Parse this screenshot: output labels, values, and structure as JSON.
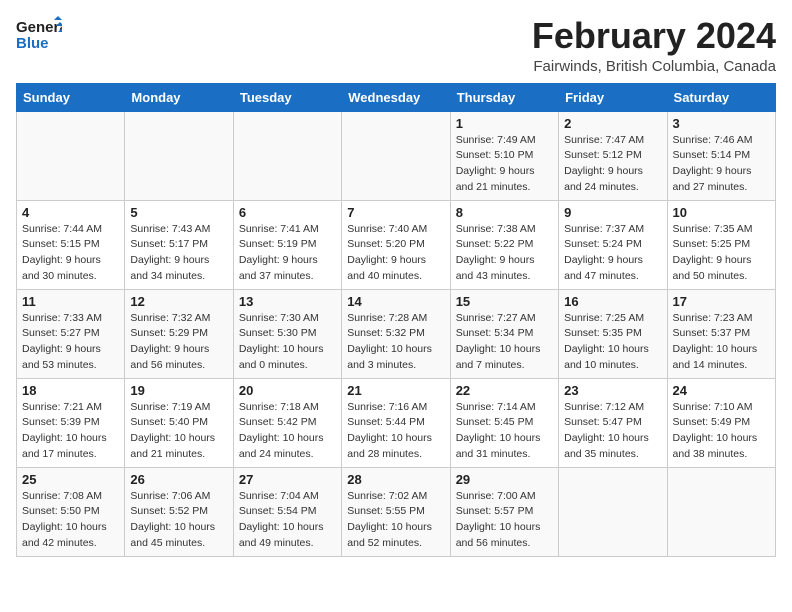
{
  "logo": {
    "line1": "General",
    "line2": "Blue"
  },
  "title": "February 2024",
  "subtitle": "Fairwinds, British Columbia, Canada",
  "days_of_week": [
    "Sunday",
    "Monday",
    "Tuesday",
    "Wednesday",
    "Thursday",
    "Friday",
    "Saturday"
  ],
  "weeks": [
    [
      {
        "day": "",
        "detail": ""
      },
      {
        "day": "",
        "detail": ""
      },
      {
        "day": "",
        "detail": ""
      },
      {
        "day": "",
        "detail": ""
      },
      {
        "day": "1",
        "detail": "Sunrise: 7:49 AM\nSunset: 5:10 PM\nDaylight: 9 hours\nand 21 minutes."
      },
      {
        "day": "2",
        "detail": "Sunrise: 7:47 AM\nSunset: 5:12 PM\nDaylight: 9 hours\nand 24 minutes."
      },
      {
        "day": "3",
        "detail": "Sunrise: 7:46 AM\nSunset: 5:14 PM\nDaylight: 9 hours\nand 27 minutes."
      }
    ],
    [
      {
        "day": "4",
        "detail": "Sunrise: 7:44 AM\nSunset: 5:15 PM\nDaylight: 9 hours\nand 30 minutes."
      },
      {
        "day": "5",
        "detail": "Sunrise: 7:43 AM\nSunset: 5:17 PM\nDaylight: 9 hours\nand 34 minutes."
      },
      {
        "day": "6",
        "detail": "Sunrise: 7:41 AM\nSunset: 5:19 PM\nDaylight: 9 hours\nand 37 minutes."
      },
      {
        "day": "7",
        "detail": "Sunrise: 7:40 AM\nSunset: 5:20 PM\nDaylight: 9 hours\nand 40 minutes."
      },
      {
        "day": "8",
        "detail": "Sunrise: 7:38 AM\nSunset: 5:22 PM\nDaylight: 9 hours\nand 43 minutes."
      },
      {
        "day": "9",
        "detail": "Sunrise: 7:37 AM\nSunset: 5:24 PM\nDaylight: 9 hours\nand 47 minutes."
      },
      {
        "day": "10",
        "detail": "Sunrise: 7:35 AM\nSunset: 5:25 PM\nDaylight: 9 hours\nand 50 minutes."
      }
    ],
    [
      {
        "day": "11",
        "detail": "Sunrise: 7:33 AM\nSunset: 5:27 PM\nDaylight: 9 hours\nand 53 minutes."
      },
      {
        "day": "12",
        "detail": "Sunrise: 7:32 AM\nSunset: 5:29 PM\nDaylight: 9 hours\nand 56 minutes."
      },
      {
        "day": "13",
        "detail": "Sunrise: 7:30 AM\nSunset: 5:30 PM\nDaylight: 10 hours\nand 0 minutes."
      },
      {
        "day": "14",
        "detail": "Sunrise: 7:28 AM\nSunset: 5:32 PM\nDaylight: 10 hours\nand 3 minutes."
      },
      {
        "day": "15",
        "detail": "Sunrise: 7:27 AM\nSunset: 5:34 PM\nDaylight: 10 hours\nand 7 minutes."
      },
      {
        "day": "16",
        "detail": "Sunrise: 7:25 AM\nSunset: 5:35 PM\nDaylight: 10 hours\nand 10 minutes."
      },
      {
        "day": "17",
        "detail": "Sunrise: 7:23 AM\nSunset: 5:37 PM\nDaylight: 10 hours\nand 14 minutes."
      }
    ],
    [
      {
        "day": "18",
        "detail": "Sunrise: 7:21 AM\nSunset: 5:39 PM\nDaylight: 10 hours\nand 17 minutes."
      },
      {
        "day": "19",
        "detail": "Sunrise: 7:19 AM\nSunset: 5:40 PM\nDaylight: 10 hours\nand 21 minutes."
      },
      {
        "day": "20",
        "detail": "Sunrise: 7:18 AM\nSunset: 5:42 PM\nDaylight: 10 hours\nand 24 minutes."
      },
      {
        "day": "21",
        "detail": "Sunrise: 7:16 AM\nSunset: 5:44 PM\nDaylight: 10 hours\nand 28 minutes."
      },
      {
        "day": "22",
        "detail": "Sunrise: 7:14 AM\nSunset: 5:45 PM\nDaylight: 10 hours\nand 31 minutes."
      },
      {
        "day": "23",
        "detail": "Sunrise: 7:12 AM\nSunset: 5:47 PM\nDaylight: 10 hours\nand 35 minutes."
      },
      {
        "day": "24",
        "detail": "Sunrise: 7:10 AM\nSunset: 5:49 PM\nDaylight: 10 hours\nand 38 minutes."
      }
    ],
    [
      {
        "day": "25",
        "detail": "Sunrise: 7:08 AM\nSunset: 5:50 PM\nDaylight: 10 hours\nand 42 minutes."
      },
      {
        "day": "26",
        "detail": "Sunrise: 7:06 AM\nSunset: 5:52 PM\nDaylight: 10 hours\nand 45 minutes."
      },
      {
        "day": "27",
        "detail": "Sunrise: 7:04 AM\nSunset: 5:54 PM\nDaylight: 10 hours\nand 49 minutes."
      },
      {
        "day": "28",
        "detail": "Sunrise: 7:02 AM\nSunset: 5:55 PM\nDaylight: 10 hours\nand 52 minutes."
      },
      {
        "day": "29",
        "detail": "Sunrise: 7:00 AM\nSunset: 5:57 PM\nDaylight: 10 hours\nand 56 minutes."
      },
      {
        "day": "",
        "detail": ""
      },
      {
        "day": "",
        "detail": ""
      }
    ]
  ]
}
